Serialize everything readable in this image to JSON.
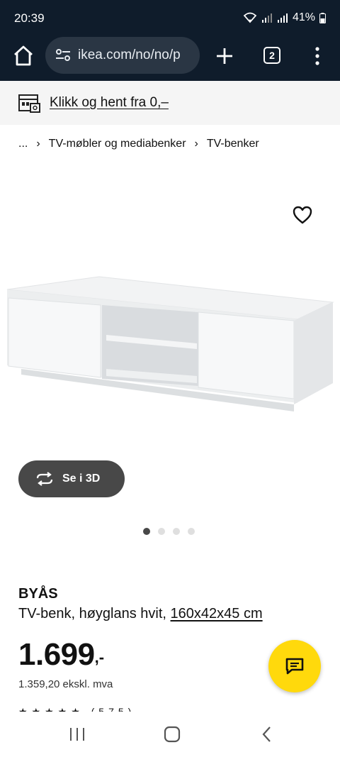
{
  "status_bar": {
    "time": "20:39",
    "battery": "41%",
    "icons": [
      "wifi-icon",
      "signal-icon",
      "signal-r-icon",
      "battery-icon"
    ]
  },
  "browser": {
    "url": "ikea.com/no/no/p",
    "tab_count": "2",
    "icons": [
      "home-icon",
      "site-settings-icon",
      "plus-icon",
      "more-icon"
    ]
  },
  "pickup_banner": {
    "text": "Klikk og hent fra 0,–",
    "icon": "store-pickup-icon"
  },
  "breadcrumb": {
    "ellipsis": "...",
    "items": [
      "TV-møbler og mediabenker",
      "TV-benker"
    ]
  },
  "gallery": {
    "view3d_label": "Se i 3D",
    "dot_count": 4,
    "active_dot": 0
  },
  "product": {
    "name": "BYÅS",
    "description": "TV-benk, høyglans hvit,",
    "measure": "160x42x45 cm",
    "price_main": "1.699",
    "price_suffix": ",-",
    "price_excl": "1.359,20 ekskl. mva"
  },
  "colors": {
    "header_bg": "#0f1c2b",
    "chat_button": "#ffd90c",
    "view3d_bg": "#484848"
  }
}
